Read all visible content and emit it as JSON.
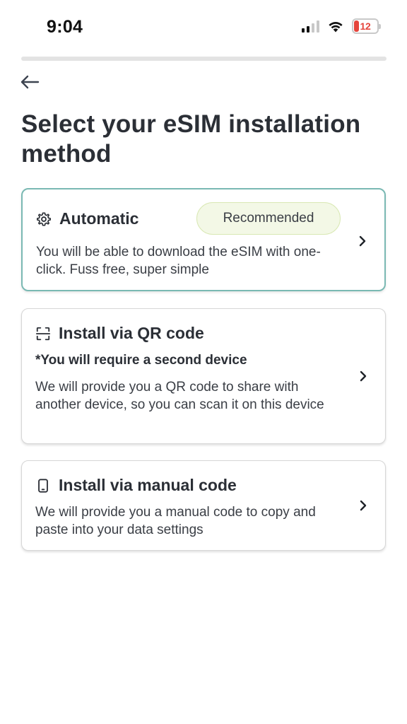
{
  "status_bar": {
    "time": "9:04",
    "battery_level": "12",
    "signal_icon": "cellular-signal-icon",
    "wifi_icon": "wifi-icon"
  },
  "nav": {
    "back_icon": "arrow-left-icon"
  },
  "page": {
    "title": "Select your eSIM installation method"
  },
  "options": [
    {
      "icon": "gear-icon",
      "title": "Automatic",
      "badge": "Recommended",
      "description": "You will be able to download the eSIM with one-click. Fuss free, super simple"
    },
    {
      "icon": "qr-scan-icon",
      "title": "Install via QR code",
      "note": "*You will require a second device",
      "description": "We will provide you a QR code to share with another device, so you can scan it on this device"
    },
    {
      "icon": "phone-device-icon",
      "title": "Install via manual code",
      "description": "We will provide you a manual code to copy and paste into your data settings"
    }
  ],
  "colors": {
    "title_text": "#2b2f36",
    "recommended_border": "#7ab9b3",
    "badge_bg": "#f3f8e6",
    "badge_border": "#d9e8b4",
    "battery_low": "#e5453c"
  }
}
